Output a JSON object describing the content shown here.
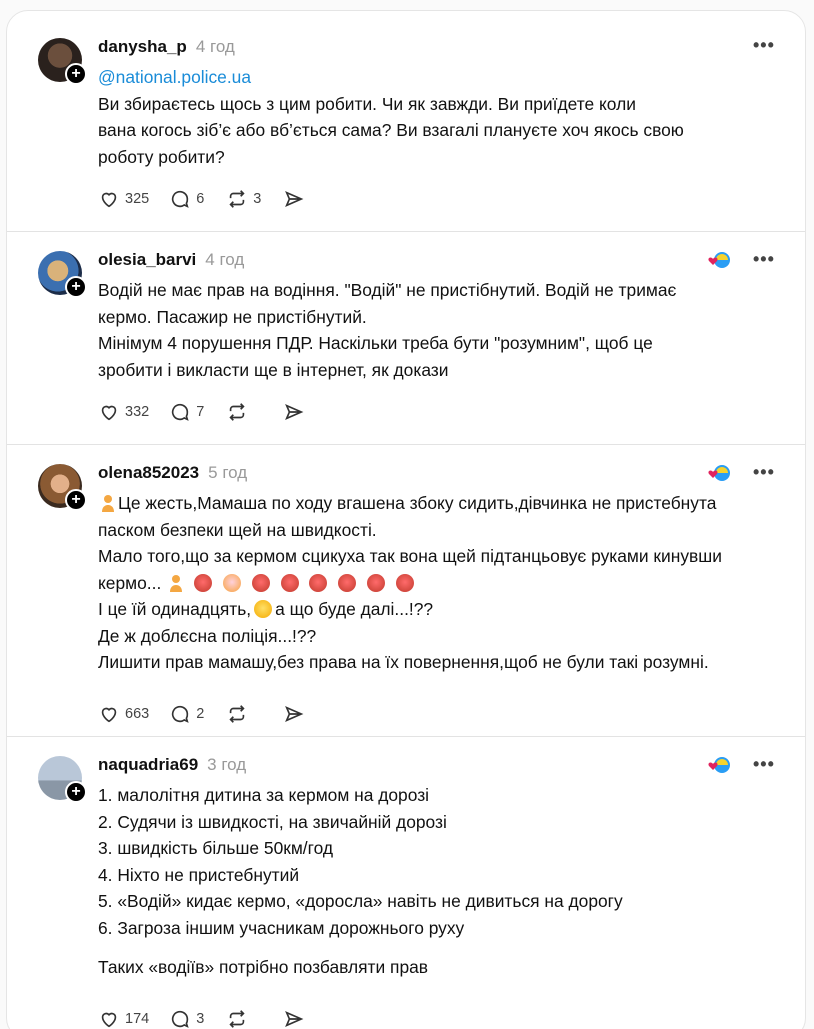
{
  "posts": [
    {
      "username": "danysha_p",
      "time": "4 год",
      "has_badge": false,
      "mention": "@national.police.ua",
      "lines": [
        "Ви збираєтесь щось з цим робити. Чи як завжди. Ви приїдете коли",
        "вана когось зіб’є або вб’ється сама? Ви взагалі плануєте хоч якось свою",
        "роботу робити?"
      ],
      "likes": "325",
      "replies": "6",
      "reposts": "3",
      "more_icon": "more-horizontal-icon"
    },
    {
      "username": "olesia_barvi",
      "time": "4 год",
      "has_badge": true,
      "lines": [
        "Водій не має прав на водіння. \"Водій\" не пристібнутий. Водій не тримає",
        "кермо. Пасажир не пристібнутий.",
        "Мінімум 4 порушення ПДР. Наскільки треба бути \"розумним\", щоб це",
        "зробити і викласти ще в інтернет, як докази"
      ],
      "likes": "332",
      "replies": "7",
      "reposts": ""
    },
    {
      "username": "olena852023",
      "time": "5 год",
      "has_badge": true,
      "lines": [
        "Це жесть,Мамаша по ходу вгашена збоку сидить,дівчинка не пристебнута",
        "паском безпеки щей на швидкості.",
        "Мало того,що за кермом сцикуха так вона щей підтанцьовує руками кинувши",
        "кермо...",
        "І це їй одинадцять,",
        "а що буде далі...!??",
        "Де ж доблєсна поліція...!??",
        "Лишити прав мамашу,без права на їх повернення,щоб не були такі розумні."
      ],
      "likes": "663",
      "replies": "2",
      "reposts": ""
    },
    {
      "username": "naquadria69",
      "time": "3 год",
      "has_badge": true,
      "lines": [
        "1. малолітня дитина за кермом на дорозі",
        "2. Судячи із швидкості, на звичайній дорозі",
        "3. швидкість більше 50км/год",
        "4. Ніхто не пристебнутий",
        "5. «Водій» кидає кермо, «доросла» навіть не дивиться на дорогу",
        "6. Загроза іншим учасникам дорожнього руху",
        "Таких «водіїв» потрібно позбавляти прав"
      ],
      "likes": "174",
      "replies": "3",
      "reposts": ""
    }
  ],
  "icons": {
    "like": "heart-icon",
    "reply": "comment-icon",
    "repost": "repost-icon",
    "share": "share-icon",
    "follow": "plus-icon"
  },
  "colors": {
    "mention": "#1a8cd8",
    "time": "#999999",
    "text": "#111111"
  }
}
